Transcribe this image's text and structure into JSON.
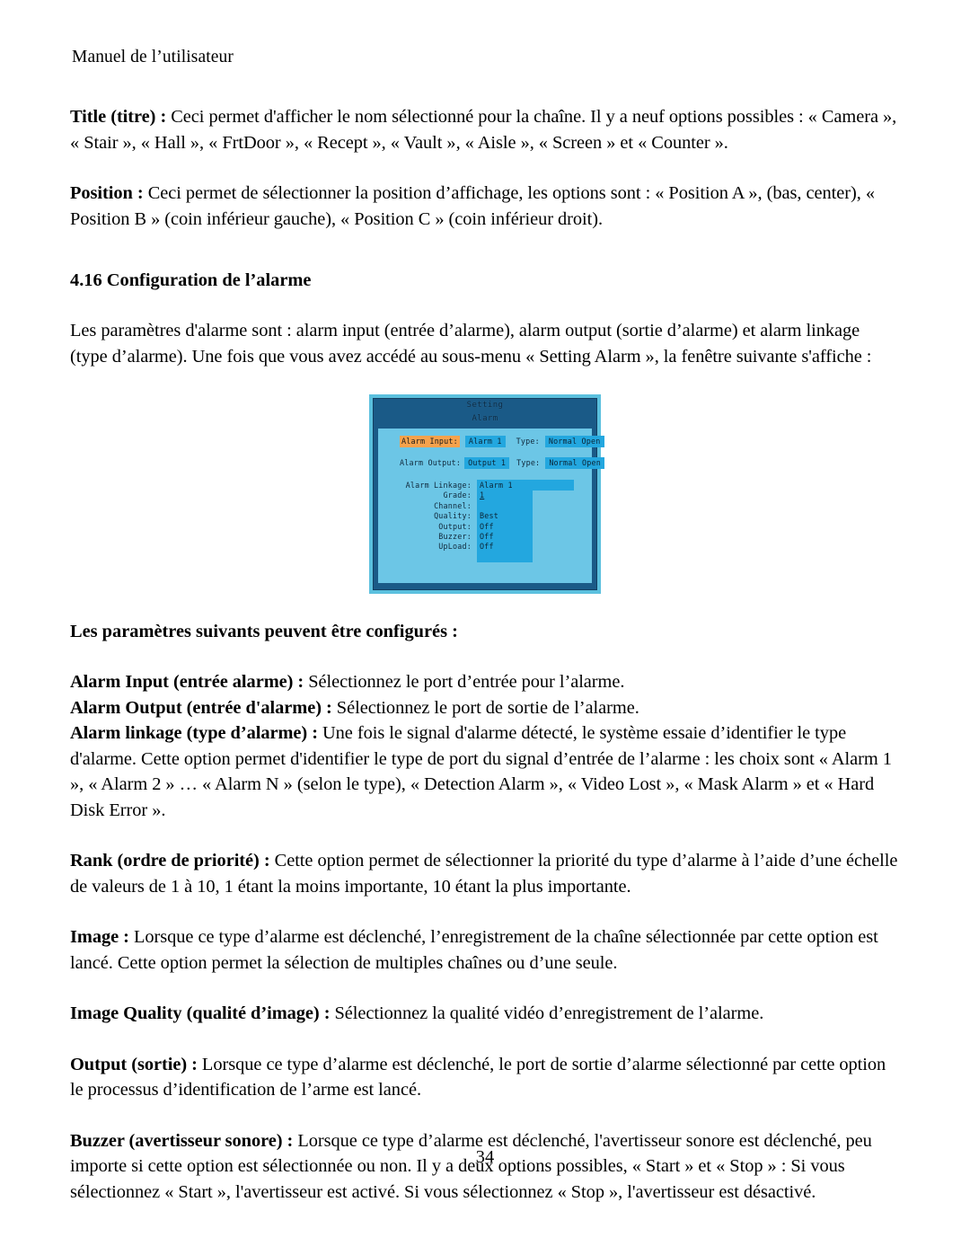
{
  "document": {
    "running_head": "Manuel de l’utilisateur",
    "page_number": "34"
  },
  "body": {
    "title_para": {
      "label": "Title (titre) :",
      "text": " Ceci permet d'afficher le nom sélectionné pour la chaîne. Il y a neuf options possibles : « Camera », « Stair », « Hall », « FrtDoor », « Recept », « Vault », « Aisle », « Screen » et « Counter »."
    },
    "position_para": {
      "label": "Position :",
      "text": " Ceci permet de sélectionner la position d’affichage, les options sont : « Position A », (bas, center), « Position B » (coin inférieur gauche), « Position C » (coin inférieur droit)."
    },
    "section_heading": "4.16 Configuration de l’alarme",
    "intro_para": "Les paramètres d'alarme sont : alarm input (entrée d’alarme), alarm output (sortie d’alarme) et alarm linkage (type d’alarme). Une fois que vous avez accédé au sous-menu « Setting Alarm », la fenêtre suivante s'affiche :",
    "params_heading": "Les paramètres suivants peuvent être configurés :",
    "alarm_input_para": {
      "label": "Alarm Input (entrée alarme) :",
      "text": " Sélectionnez le port d’entrée pour l’alarme."
    },
    "alarm_output_para": {
      "label": "Alarm Output (entrée d'alarme) :",
      "text": " Sélectionnez le port de sortie de l’alarme."
    },
    "alarm_linkage_para": {
      "label": "Alarm linkage (type d’alarme) :",
      "text": " Une fois le signal d'alarme détecté, le système essaie d’identifier le type d'alarme. Cette option permet d'identifier le type de port du signal d’entrée de l’alarme : les choix sont « Alarm 1 », « Alarm 2 » … « Alarm N » (selon le type), « Detection Alarm », « Video Lost », « Mask Alarm » et « Hard Disk Error  »."
    },
    "rank_para": {
      "label": "Rank (ordre de priorité) :",
      "text": " Cette option permet de sélectionner la priorité du type d’alarme à l’aide d’une échelle de valeurs de 1 à 10, 1 étant la moins importante, 10 étant la plus importante."
    },
    "image_para": {
      "label": "Image :",
      "text": " Lorsque ce type d’alarme est déclenché, l’enregistrement de la chaîne sélectionnée par cette option est lancé. Cette option permet la sélection de multiples chaînes ou d’une seule."
    },
    "image_quality_para": {
      "label": "Image Quality (qualité d’image) :",
      "text": " Sélectionnez la qualité vidéo d’enregistrement de l’alarme."
    },
    "output_para": {
      "label": "Output (sortie) :",
      "text": " Lorsque ce type d’alarme est déclenché, le port de sortie d’alarme sélectionné par cette option le processus d’identification de l’arme est lancé."
    },
    "buzzer_para": {
      "label": "Buzzer (avertisseur sonore) :",
      "text": " Lorsque ce type d’alarme est déclenché, l'avertisseur sonore est déclenché, peu importe si cette option est sélectionnée ou non. Il y a deux options possibles, « Start » et « Stop » : Si vous sélectionnez « Start », l'avertisseur est activé. Si vous sélectionnez « Stop », l'avertisseur est désactivé."
    }
  },
  "osd_dialog": {
    "title_line1": "Setting",
    "title_line2": "Alarm",
    "alarm_input": {
      "label": "Alarm Input:",
      "value": "Alarm 1",
      "type_label": "Type:",
      "type_value": "Normal Open"
    },
    "alarm_output": {
      "label": "Alarm Output:",
      "value": "Output 1",
      "type_label": "Type:",
      "type_value": "Normal Open"
    },
    "alarm_linkage": {
      "label": "Alarm Linkage:",
      "value": "Alarm 1",
      "fields": [
        {
          "label": "Grade:",
          "value": "1"
        },
        {
          "label": "Channel:",
          "value": ""
        },
        {
          "label": "Quality:",
          "value": "Best"
        },
        {
          "label": "Output:",
          "value": "Off"
        },
        {
          "label": "Buzzer:",
          "value": "Off"
        },
        {
          "label": "UpLoad:",
          "value": "Off"
        }
      ]
    },
    "colors": {
      "outer_border": "#5bc0de",
      "frame": "#1a5a87",
      "body": "#6cc6e6",
      "value_bg": "#23a7df",
      "highlight_bg": "#f6a24c",
      "text": "#10293c"
    }
  }
}
